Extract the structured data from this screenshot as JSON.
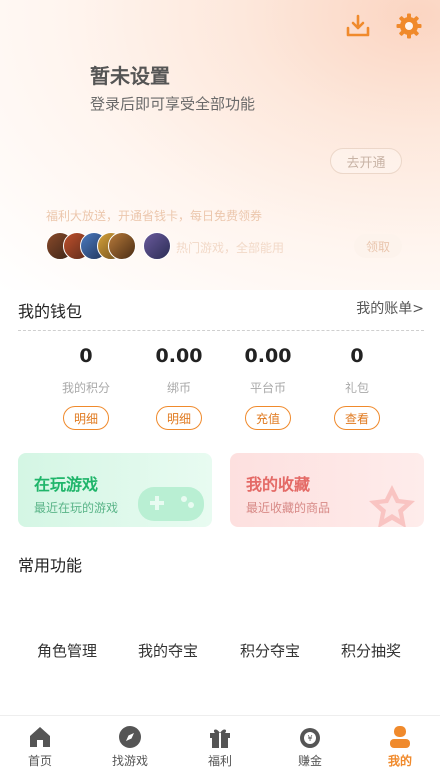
{
  "header": {
    "download_icon": "download-icon",
    "settings_icon": "gear-icon"
  },
  "profile": {
    "name": "暂未设置",
    "subtitle": "登录后即可享受全部功能"
  },
  "vip": {
    "open_label": "去开通",
    "promo_text": "福利大放送，开通省钱卡，每日免费领券",
    "hot_text": "热门游戏，全部能用",
    "claim_label": "领取"
  },
  "wallet": {
    "title": "我的钱包",
    "bill_link": "我的账单>",
    "stats": [
      {
        "value": "0",
        "label": "我的积分",
        "button": "明细"
      },
      {
        "value": "0.00",
        "label": "绑币",
        "button": "明细"
      },
      {
        "value": "0.00",
        "label": "平台币",
        "button": "充值"
      },
      {
        "value": "0",
        "label": "礼包",
        "button": "查看"
      }
    ]
  },
  "cards": {
    "playing": {
      "title": "在玩游戏",
      "subtitle": "最近在玩的游戏"
    },
    "favorites": {
      "title": "我的收藏",
      "subtitle": "最近收藏的商品"
    }
  },
  "common": {
    "title": "常用功能",
    "items": [
      "角色管理",
      "我的夺宝",
      "积分夺宝",
      "积分抽奖"
    ]
  },
  "tabbar": {
    "items": [
      {
        "label": "首页",
        "icon": "home-icon"
      },
      {
        "label": "找游戏",
        "icon": "compass-icon"
      },
      {
        "label": "福利",
        "icon": "gift-icon"
      },
      {
        "label": "赚金",
        "icon": "money-bag-icon"
      },
      {
        "label": "我的",
        "icon": "user-icon"
      }
    ],
    "active_index": 4
  },
  "colors": {
    "accent": "#f08a2c",
    "green": "#1fb56a",
    "red": "#e46a66"
  }
}
